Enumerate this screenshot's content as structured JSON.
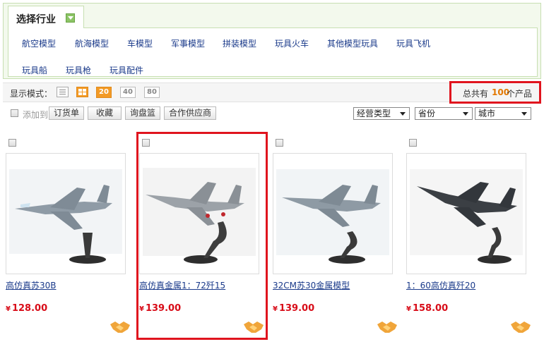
{
  "industry": {
    "tab_title": "选择行业",
    "toggle_icon": "chevron-down-icon",
    "categories": [
      "航空模型",
      "航海模型",
      "车模型",
      "军事模型",
      "拼装模型",
      "玩具火车",
      "其他模型玩具",
      "玩具飞机",
      "玩具船",
      "玩具枪",
      "玩具配件"
    ]
  },
  "display": {
    "label": "显示模式：",
    "views": [
      "list-view-icon",
      "grid-view-icon"
    ],
    "active_view": "grid-view-icon",
    "page_sizes": [
      "20",
      "40",
      "80"
    ],
    "active_page_size": "20",
    "total_prefix": "总共有",
    "total_count": "100",
    "total_suffix": "个产品"
  },
  "actions": {
    "add_to_label": "添加到",
    "buttons": [
      "订货单",
      "收藏",
      "询盘篮",
      "合作供应商"
    ]
  },
  "filters": {
    "business_type": "经营类型",
    "province": "省份",
    "city": "城市"
  },
  "products": [
    {
      "name": "高仿真苏30B",
      "currency": "¥",
      "price": "128.00",
      "image": "su-30-jet-model",
      "highlighted": false
    },
    {
      "name": "高仿真金属1：72歼15",
      "currency": "¥",
      "price": "139.00",
      "image": "j-15-jet-model",
      "highlighted": true
    },
    {
      "name": "32CM苏30金属模型",
      "currency": "¥",
      "price": "139.00",
      "image": "su-30-metal-jet-model",
      "highlighted": false
    },
    {
      "name": "1：60高仿真歼20",
      "currency": "¥",
      "price": "158.00",
      "image": "j-20-jet-model",
      "highlighted": false
    }
  ],
  "colors": {
    "accent_orange": "#f39a24",
    "price_red": "#d80c18",
    "highlight_red": "#e0141e",
    "link_blue": "#1a3a8a",
    "panel_green": "#c7dfb2"
  }
}
